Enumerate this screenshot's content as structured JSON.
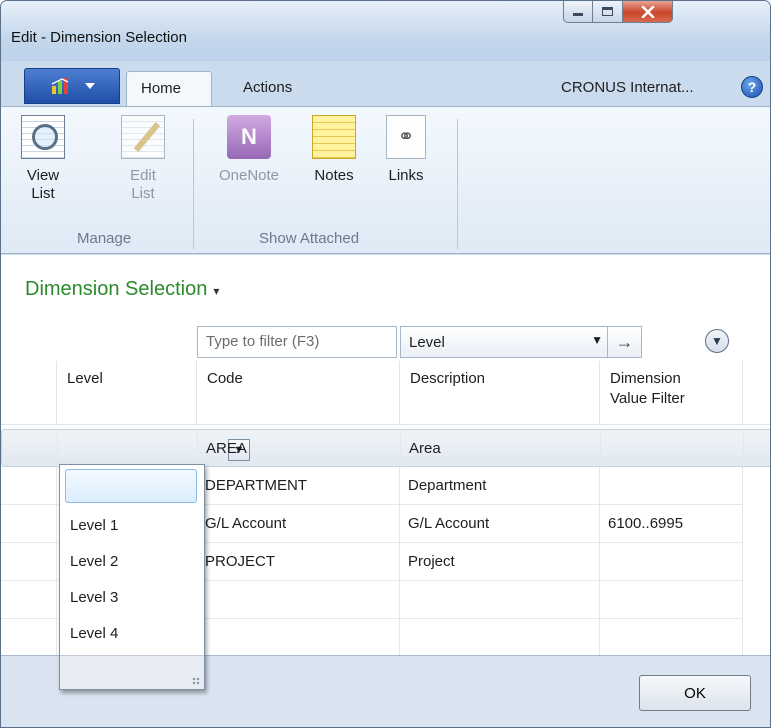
{
  "window": {
    "title": "Edit - Dimension Selection"
  },
  "ribbon": {
    "tabs": [
      "Home",
      "Actions"
    ],
    "company": "CRONUS Internat...",
    "help": "?",
    "buttons": {
      "view_list": "View List",
      "view_list_l1": "View",
      "view_list_l2": "List",
      "edit_list_l1": "Edit",
      "edit_list_l2": "List",
      "onenote": "OneNote",
      "notes": "Notes",
      "links": "Links"
    },
    "groups": {
      "manage": "Manage",
      "show_attached": "Show Attached"
    }
  },
  "page": {
    "title": "Dimension Selection"
  },
  "filter": {
    "placeholder": "Type to filter (F3)",
    "field": "Level"
  },
  "table": {
    "headers": {
      "level": "Level",
      "code": "Code",
      "description": "Description",
      "filter_l1": "Dimension",
      "filter_l2": "Value Filter"
    },
    "rows": [
      {
        "level": "",
        "code": "AREA",
        "description": "Area",
        "filter": ""
      },
      {
        "level": "",
        "code": "DEPARTMENT",
        "description": "Department",
        "filter": ""
      },
      {
        "level": "",
        "code": "G/L Account",
        "description": "G/L Account",
        "filter": "6100..6995"
      },
      {
        "level": "",
        "code": "PROJECT",
        "description": "Project",
        "filter": ""
      }
    ]
  },
  "dropdown": {
    "options": [
      "",
      "Level 1",
      "Level 2",
      "Level 3",
      "Level 4"
    ]
  },
  "footer": {
    "ok": "OK"
  },
  "icons": {
    "app_menu": "app-menu-icon",
    "help": "help-icon",
    "view_list": "view-list-icon",
    "edit_list": "edit-list-icon",
    "onenote": "onenote-icon",
    "notes": "notes-icon",
    "links": "links-icon"
  },
  "colors": {
    "page_title": "#2c8a2c",
    "close_button": "#c9452b",
    "app_menu": "#1f4fa8"
  }
}
